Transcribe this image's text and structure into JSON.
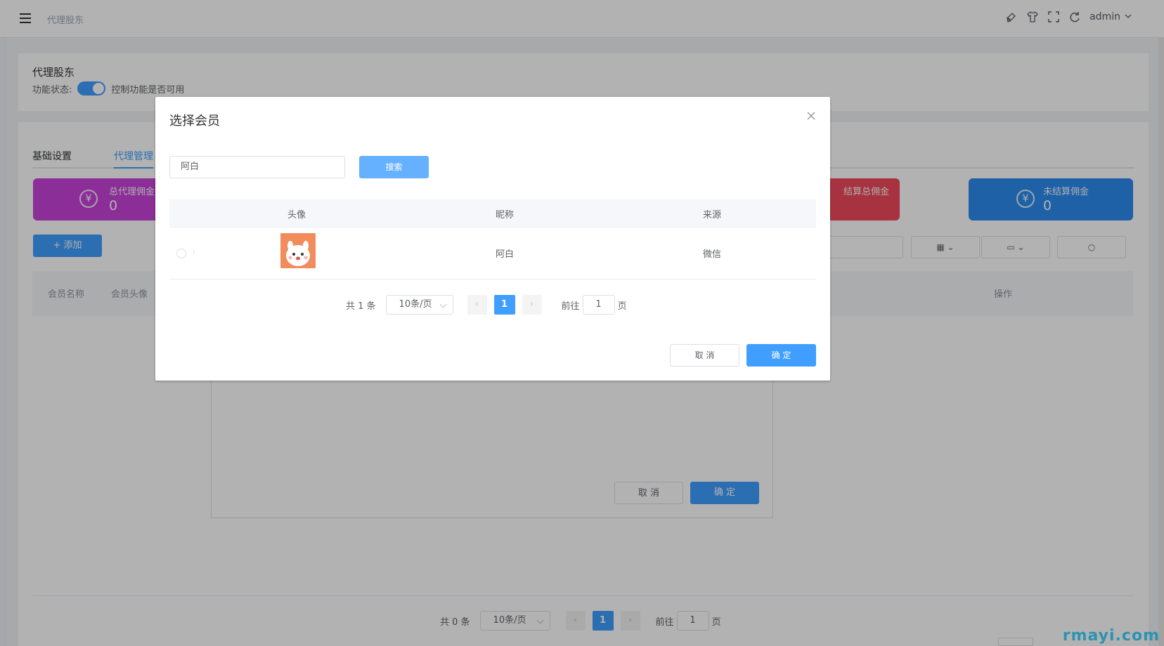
{
  "header": {
    "breadcrumb": "代理股东",
    "user": "admin",
    "icons": [
      "paint-icon",
      "shirt-icon",
      "fullscreen-icon",
      "refresh-icon"
    ]
  },
  "feature": {
    "title": "代理股东",
    "status_label": "功能状态:",
    "status_hint": "控制功能是否可用",
    "enabled": true
  },
  "tabs": [
    {
      "label": "基础设置"
    },
    {
      "label": "代理管理"
    }
  ],
  "stats": [
    {
      "label": "总代理佣金",
      "value": "0",
      "color": "#c843d8",
      "icon": "¥"
    },
    {
      "label": "结算总佣金",
      "value": "",
      "color": "#f04a5c",
      "icon": "¥"
    },
    {
      "label": "未结算佣金",
      "value": "0",
      "color": "#2d8cf0",
      "icon": "¥"
    }
  ],
  "list": {
    "add_label": "+ 添加",
    "columns": [
      "会员名称",
      "会员头像",
      "操作"
    ],
    "pager": {
      "total": "共 0 条",
      "page_size": "10条/页",
      "current": "1",
      "goto_label": "前往",
      "goto_value": "1",
      "page_unit": "页"
    }
  },
  "bg_dialog": {
    "cancel": "取 消",
    "ok": "确 定"
  },
  "dialog": {
    "title": "选择会员",
    "search_value": "阿白",
    "search_button": "搜索",
    "columns": {
      "avatar": "头像",
      "nickname": "昵称",
      "source": "来源"
    },
    "rows": [
      {
        "radio_label": ":",
        "nickname": "阿白",
        "source": "微信"
      }
    ],
    "pager": {
      "total": "共 1 条",
      "page_size": "10条/页",
      "current": "1",
      "goto_label": "前往",
      "goto_value": "1",
      "page_unit": "页"
    },
    "cancel": "取 消",
    "ok": "确 定"
  },
  "watermark": "rmayi.com"
}
